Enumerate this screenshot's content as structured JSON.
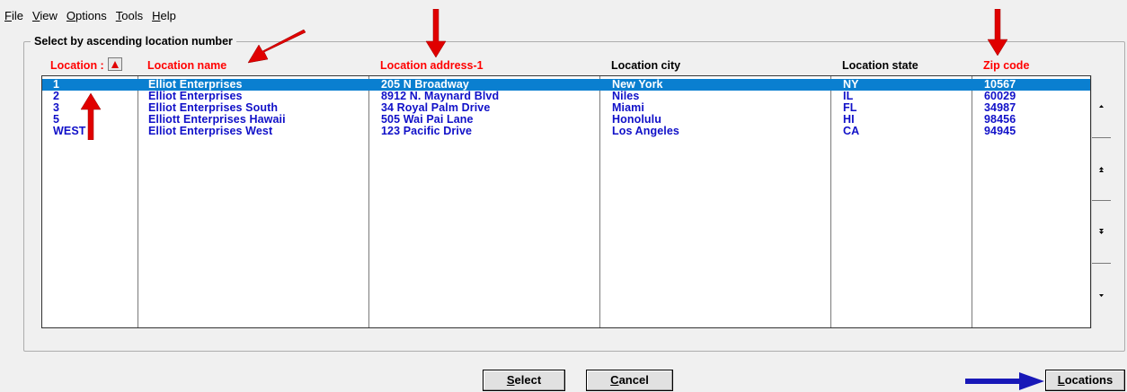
{
  "menu": [
    {
      "label": "File",
      "hotkey": "F"
    },
    {
      "label": "View",
      "hotkey": "V"
    },
    {
      "label": "Options",
      "hotkey": "O"
    },
    {
      "label": "Tools",
      "hotkey": "T"
    },
    {
      "label": "Help",
      "hotkey": "H"
    }
  ],
  "group_title": "Select by ascending location number",
  "columns": {
    "location": "Location :",
    "location_name": "Location name",
    "address": "Location address-1",
    "city": "Location city",
    "state": "Location state",
    "zip": "Zip code"
  },
  "rows": [
    {
      "location": "1",
      "name": "Elliot Enterprises",
      "address": "205 N Broadway",
      "city": "New York",
      "state": "NY",
      "zip": "10567",
      "selected": true
    },
    {
      "location": "2",
      "name": "Elliot Enterprises",
      "address": "8912 N. Maynard Blvd",
      "city": "Niles",
      "state": "IL",
      "zip": "60029"
    },
    {
      "location": "3",
      "name": "Elliot Enterprises South",
      "address": "34 Royal Palm Drive",
      "city": "Miami",
      "state": "FL",
      "zip": "34987"
    },
    {
      "location": "5",
      "name": "Elliott Enterprises Hawaii",
      "address": "505 Wai Pai Lane",
      "city": "Honolulu",
      "state": "HI",
      "zip": "98456"
    },
    {
      "location": "WEST",
      "name": "Elliot Enterprises West",
      "address": "123 Pacific Drive",
      "city": "Los Angeles",
      "state": "CA",
      "zip": "94945"
    }
  ],
  "buttons": {
    "select": {
      "label": "Select",
      "hotkey": "S"
    },
    "cancel": {
      "label": "Cancel",
      "hotkey": "C"
    },
    "locations": {
      "label": "Locations",
      "hotkey": "L"
    }
  },
  "colors": {
    "highlight_header": "#ff0000",
    "row_text": "#1010c8",
    "selection": "#0a7fd0",
    "annotation_arrow_red": "#e00000",
    "annotation_arrow_blue": "#1818b8"
  }
}
